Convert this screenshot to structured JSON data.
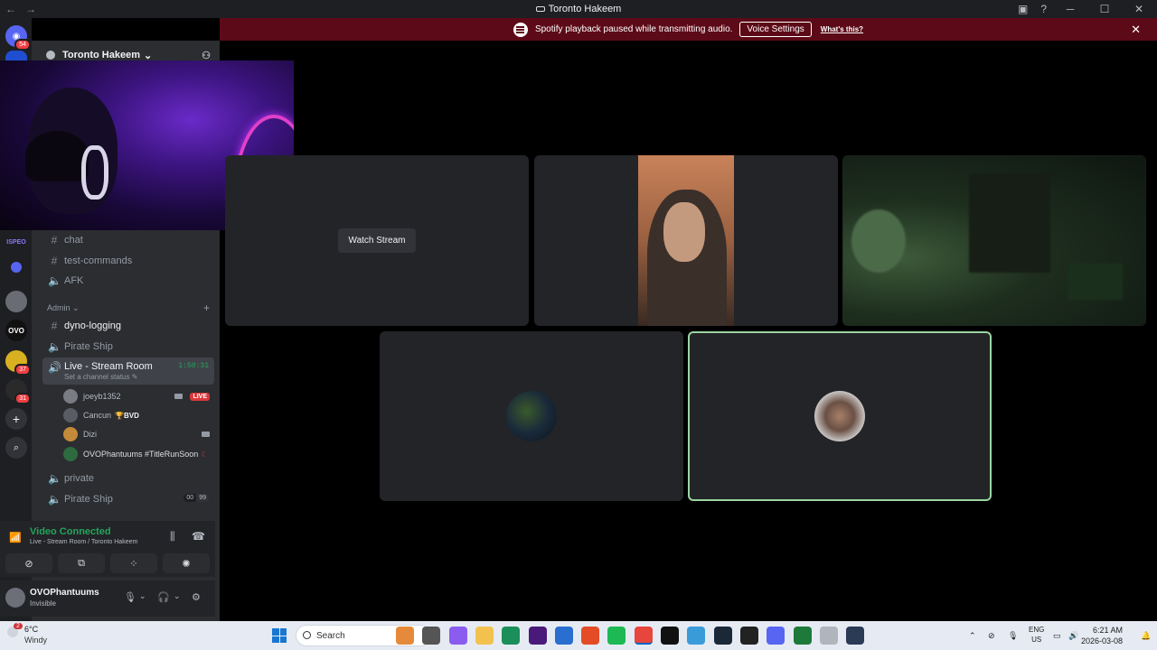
{
  "window": {
    "title": "Toronto Hakeem",
    "back": "←",
    "forward": "→",
    "inbox_icon": "inbox-icon",
    "help": "?",
    "minimize": "─",
    "maximize": "☐",
    "close": "✕"
  },
  "server_rail": {
    "home_badge": "54",
    "servers": [
      {
        "label": "ISPEO"
      },
      {
        "label": ""
      },
      {
        "label": ""
      },
      {
        "label": "OVO"
      },
      {
        "label": "",
        "badge": "37"
      },
      {
        "label": "",
        "badge": "31"
      }
    ],
    "add": "+",
    "discover": "⌕"
  },
  "server": {
    "name": "Toronto Hakeem",
    "chevron": "⌄"
  },
  "channels": [
    {
      "type": "text",
      "name": "chat"
    },
    {
      "type": "text",
      "name": "test-commands"
    },
    {
      "type": "voice",
      "name": "AFK"
    }
  ],
  "category": {
    "name": "Admin",
    "chevron": "⌄",
    "add": "+"
  },
  "admin_channels": [
    {
      "type": "text",
      "name": "dyno-logging"
    },
    {
      "type": "voice",
      "name": "Pirate Ship"
    }
  ],
  "active_channel": {
    "name": "Live - Stream Room",
    "timer": "1:50:31",
    "status": "Set a channel status ✎"
  },
  "members": [
    {
      "name": "joeyb1352",
      "live": "LIVE",
      "color": "#7a7c84"
    },
    {
      "name": "Cancun",
      "badge": "🏆BVD",
      "color": "#5a5c64"
    },
    {
      "name": "Dizi",
      "color": "#c48a3a"
    },
    {
      "name": "OVOPhantuums #TitleRunSoon",
      "moon": "☾",
      "color": "#2e6b3f"
    }
  ],
  "bottom_channels": [
    {
      "type": "voice",
      "name": "private"
    },
    {
      "type": "voice",
      "name": "Pirate Ship",
      "pill": [
        "00",
        "99"
      ]
    }
  ],
  "voice_panel": {
    "title": "Video Connected",
    "subtitle": "Live - Stream Room / Toronto Hakeem",
    "buttons": [
      "camera-off-icon",
      "screen-share-icon",
      "activities-icon",
      "soundboard-icon"
    ]
  },
  "user_panel": {
    "username": "OVOPhantuums",
    "status": "Invisible"
  },
  "notice": {
    "text": "Spotify playback paused while transmitting audio.",
    "button": "Voice Settings",
    "link": "What's this?",
    "close": "✕"
  },
  "stage": {
    "watch_stream": "Watch Stream"
  },
  "taskbar": {
    "weather_badge": "2",
    "temp": "6°C",
    "condition": "Windy",
    "search_placeholder": "Search",
    "lang_top": "ENG",
    "lang_bottom": "US",
    "time": "6:21 AM",
    "date": "2026-03-08",
    "app_colors": [
      "#e58a3a",
      "#555",
      "#8a5cf0",
      "#f2c14e",
      "#1b8f5a",
      "#4a1a7a",
      "#2a6fcf",
      "#e34c26",
      "#1db954",
      "#e8453c",
      "#111",
      "#3a9bd9",
      "#1b2838",
      "#222",
      "#5865f2",
      "#1e7a3a",
      "#b0b4bc",
      "#2b3a55"
    ]
  },
  "colors": {
    "accent_green": "#23a55a",
    "notice_bg": "#5c0a17",
    "sidebar_bg": "#2b2d31",
    "live_red": "#da373c"
  }
}
